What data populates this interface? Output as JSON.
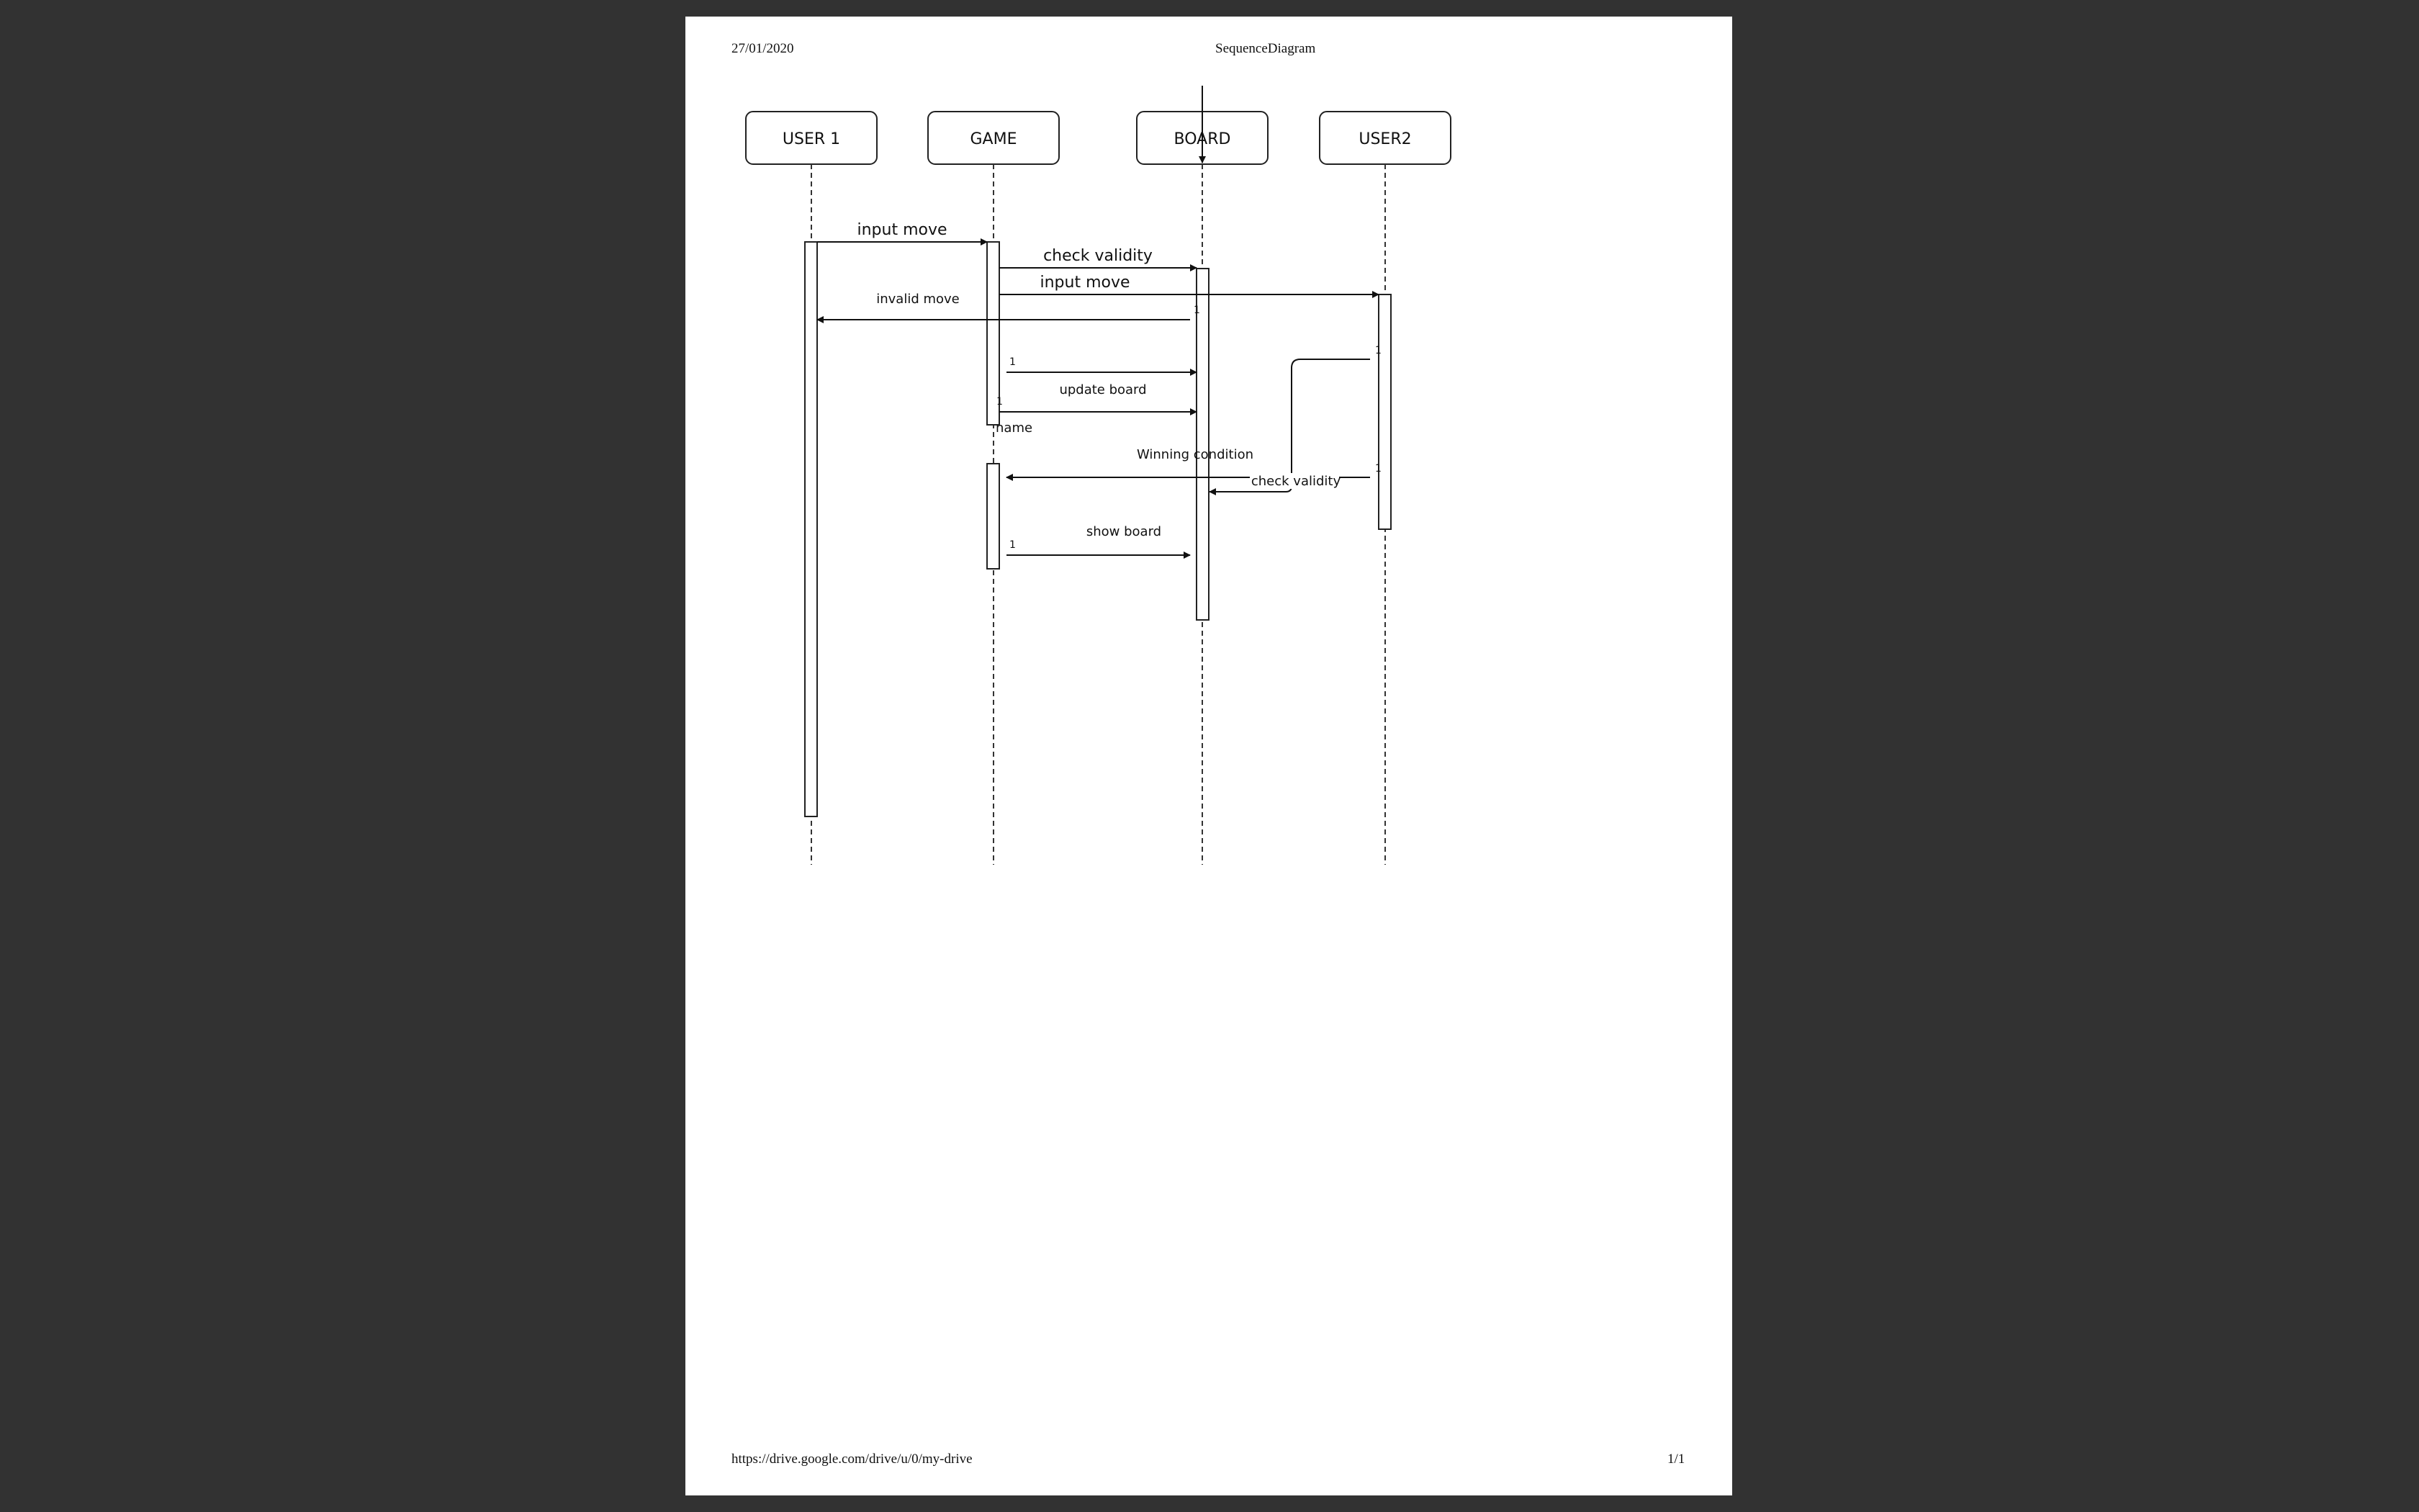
{
  "page": {
    "header_date": "27/01/2020",
    "header_title": "SequenceDiagram",
    "footer_url": "https://drive.google.com/drive/u/0/my-drive",
    "footer_page": "1/1"
  },
  "diagram": {
    "lifelines": [
      "USER 1",
      "GAME",
      "BOARD",
      "USER2"
    ],
    "messages": [
      {
        "id": "m-input-move-1",
        "label": "input move",
        "from": "USER 1",
        "to": "GAME",
        "multiplicity": ""
      },
      {
        "id": "m-check-validity-1",
        "label": "check validity",
        "from": "GAME",
        "to": "BOARD",
        "multiplicity": ""
      },
      {
        "id": "m-input-move-2",
        "label": "input move",
        "from": "GAME",
        "to": "USER2",
        "multiplicity": ""
      },
      {
        "id": "m-invalid-move",
        "label": "invalid move",
        "from": "BOARD",
        "to": "USER 1",
        "multiplicity": "1"
      },
      {
        "id": "m-to-board",
        "label": "",
        "from": "GAME",
        "to": "BOARD",
        "multiplicity": "1"
      },
      {
        "id": "m-update-board",
        "label": "update board",
        "from": "GAME",
        "to": "BOARD",
        "multiplicity": "1"
      },
      {
        "id": "m-winning-condition",
        "label": "Winning condition",
        "from": "USER2",
        "to": "GAME",
        "multiplicity": "1"
      },
      {
        "id": "m-check-validity-2",
        "label": "check validity",
        "from": "USER2",
        "to": "BOARD",
        "multiplicity": "1"
      },
      {
        "id": "m-show-board",
        "label": "show board",
        "from": "GAME",
        "to": "BOARD",
        "multiplicity": "1"
      }
    ],
    "annotations": [
      "name"
    ]
  }
}
